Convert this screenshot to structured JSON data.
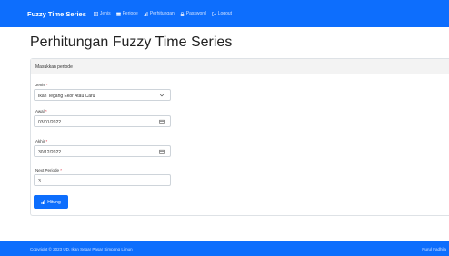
{
  "nav": {
    "brand": "Fuzzy Time Series",
    "items": [
      {
        "label": "Jenis",
        "icon": "table-icon"
      },
      {
        "label": "Periode",
        "icon": "calendar-icon"
      },
      {
        "label": "Perhitungan",
        "icon": "bar-chart-icon"
      },
      {
        "label": "Password",
        "icon": "lock-icon"
      },
      {
        "label": "Logout",
        "icon": "logout-icon"
      }
    ]
  },
  "page": {
    "title": "Perhitungan Fuzzy Time Series"
  },
  "card": {
    "header": "Masukkan periode"
  },
  "form": {
    "jenis": {
      "label": "Jenis",
      "required": "*",
      "value": "Ikan Tegang Ekor Atau Caru"
    },
    "awal": {
      "label": "Awal",
      "required": "*",
      "value": "03/01/2022"
    },
    "akhir": {
      "label": "Akhir",
      "required": "*",
      "value": "30/12/2022"
    },
    "next_periode": {
      "label": "Next Periode",
      "required": "*",
      "value": "3"
    },
    "submit_label": "Hitung"
  },
  "footer": {
    "copyright": "Copyright © 2023 UD. Ikan Segar Pasar Simpang Limun",
    "author": "Nurul Fadhila"
  },
  "colors": {
    "primary": "#0d6efd",
    "required": "#dc3545"
  }
}
